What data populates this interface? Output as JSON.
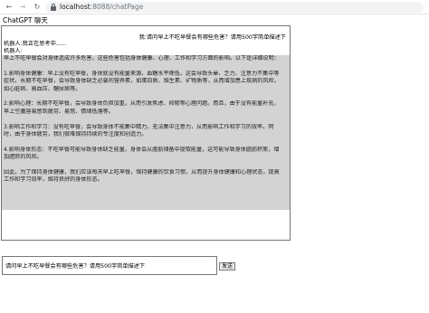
{
  "browser": {
    "url_host": "localhost",
    "url_path": ":8088/chatPage"
  },
  "page": {
    "title": "ChatGPT 聊天"
  },
  "chat": {
    "user_message": "我:请问早上不吃早餐会有哪些危害？请用500字简单描述下",
    "bot_status": "机器人:我正在思考中......",
    "bot_label": "机器人:",
    "reply_lines": [
      "早上不吃早餐会对身体造成许多危害，这些危害包括身体健康、心理、工作和学习方面的影响。以下是详细说明：",
      "",
      "1.影响身体健康：早上没有吃早餐，身体就没有能量来源，血糖水平降低，这会导致头晕、乏力、注意力不集中等",
      "症状。长期不吃早餐，会导致身体缺乏必要的营养素，如蛋白质、维生素、矿物质等，从而增加患上疾病的风险，",
      "如心脏病、高血压、糖尿病等。",
      "",
      "2.影响心理：长期不吃早餐，会导致身体负担加重，从而引发焦虑、抑郁等心理问题。而且，由于没有能量补充，",
      "早上空腹容易感到疲劳、易怒、情绪低落等。",
      "",
      "3.影响工作和学习：没有吃早餐，会导致身体不能集中精力，无法集中注意力，从而影响工作和学习的效率。同",
      "时，由于身体疲劳，我们很难保持持续的专注度和创造力。",
      "",
      "4.影响身体形态：不吃早餐可能导致身体缺乏能量，身体会从脂肪储备中提取能量，这可能导致身体脂肪积累，增",
      "加肥胖的风险。",
      "",
      "因此，为了保持身体健康，我们应该每天早上吃早餐，保持健康的饮食习惯，从而提升身体健康和心理状态，提高",
      "工作和学习效率，维持良好的身体形态。"
    ]
  },
  "input": {
    "value": "请问早上不吃早餐会有哪些危害？请用500字简单描述下",
    "send_label": "发送"
  }
}
